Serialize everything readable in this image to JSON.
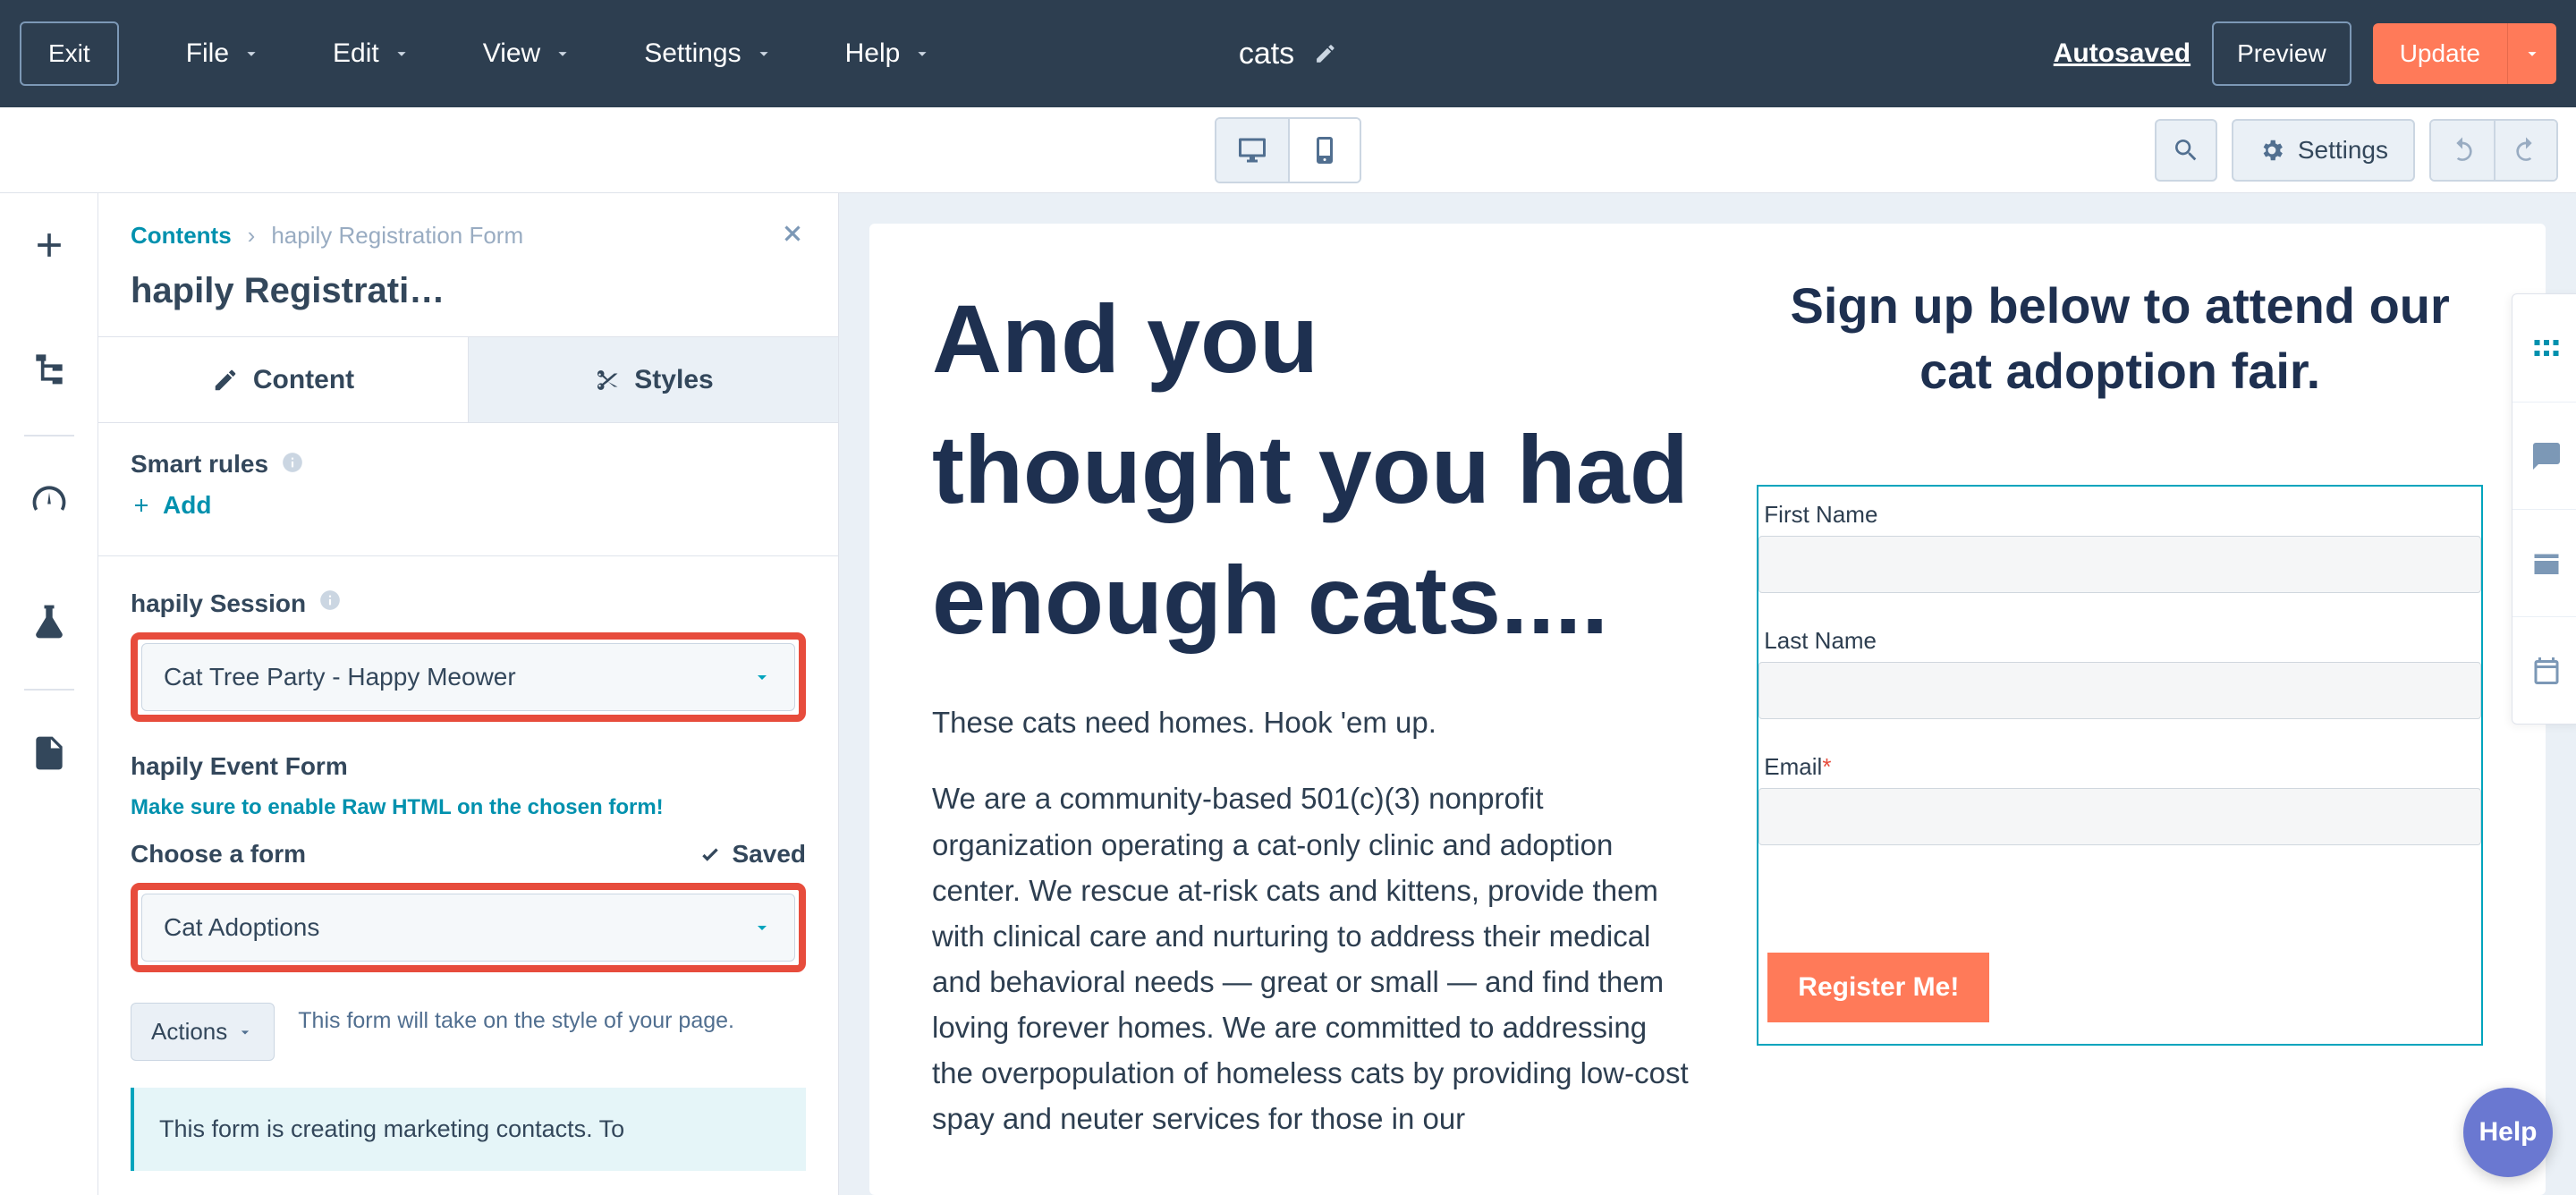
{
  "topbar": {
    "exit": "Exit",
    "menus": [
      "File",
      "Edit",
      "View",
      "Settings",
      "Help"
    ],
    "page_title": "cats",
    "autosaved": "Autosaved",
    "preview": "Preview",
    "update": "Update"
  },
  "secondbar": {
    "settings": "Settings"
  },
  "panel": {
    "bc_root": "Contents",
    "bc_current": "hapily Registration Form",
    "heading": "hapily Registrati…",
    "tabs": {
      "content": "Content",
      "styles": "Styles"
    },
    "smart_rules": "Smart rules",
    "add": "Add",
    "session_label": "hapily Session",
    "session_value": "Cat Tree Party - Happy Meower",
    "event_form_label": "hapily Event Form",
    "event_form_help": "Make sure to enable Raw HTML on the chosen form!",
    "choose_form": "Choose a form",
    "saved": "Saved",
    "form_value": "Cat Adoptions",
    "actions": "Actions",
    "form_note": "This form will take on the style of your page.",
    "banner": "This form is creating marketing contacts. To"
  },
  "page": {
    "hero": "And you thought you had enough cats....",
    "sub": "These cats need homes. Hook 'em up.",
    "body": "We are a community-based 501(c)(3) nonprofit organization operating a cat-only clinic and adoption center. We rescue at-risk cats and kittens, provide them with clinical care and nurturing to address their medical and behavioral needs — great or small — and find them loving forever homes. We are committed to addressing the overpopulation of homeless cats by providing low-cost spay and neuter services for those in our",
    "signup_heading": "Sign up below to attend our cat adoption fair.",
    "form": {
      "first_name": "First Name",
      "last_name": "Last Name",
      "email": "Email",
      "submit": "Register Me!"
    }
  },
  "help": "Help"
}
